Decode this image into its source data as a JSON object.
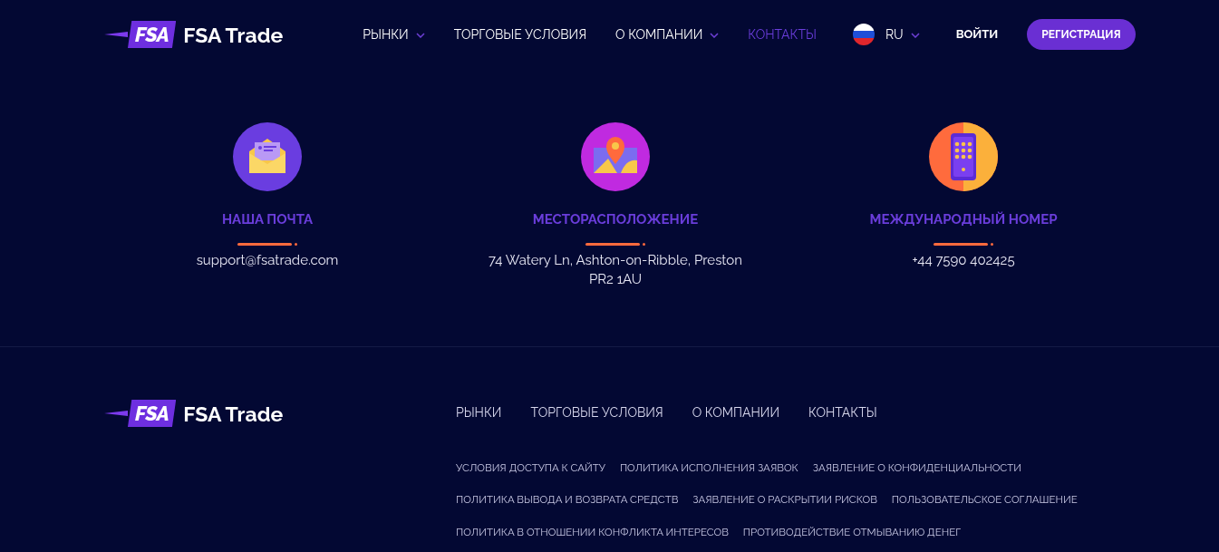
{
  "header": {
    "logo": {
      "mark": "FSA",
      "name": "FSA Trade"
    },
    "nav": [
      {
        "label": "РЫНКИ",
        "dropdown": true,
        "selected": false
      },
      {
        "label": "ТОРГОВЫЕ УСЛОВИЯ",
        "dropdown": false,
        "selected": false
      },
      {
        "label": "О КОМПАНИИ",
        "dropdown": true,
        "selected": false
      },
      {
        "label": "КОНТАКТЫ",
        "dropdown": false,
        "selected": true
      }
    ],
    "language": {
      "code": "RU"
    },
    "login": "ВОЙТИ",
    "register": "РЕГИСТРАЦИЯ"
  },
  "contacts": [
    {
      "kind": "mail",
      "title": "НАША ПОЧТА",
      "lines": [
        "support@fsatrade.com"
      ]
    },
    {
      "kind": "location",
      "title": "МЕСТОРАСПОЛОЖЕНИЕ",
      "lines": [
        "74 Watery Ln, Ashton-on-Ribble, Preston",
        "PR2 1AU"
      ]
    },
    {
      "kind": "phone",
      "title": "МЕЖДУНАРОДНЫЙ НОМЕР",
      "lines": [
        "+44 7590 402425"
      ]
    }
  ],
  "footer": {
    "logo": {
      "mark": "FSA",
      "name": "FSA Trade"
    },
    "nav": [
      "РЫНКИ",
      "ТОРГОВЫЕ УСЛОВИЯ",
      "О КОМПАНИИ",
      "КОНТАКТЫ"
    ],
    "legal_rows": [
      [
        "УСЛОВИЯ ДОСТУПА К САЙТУ",
        "ПОЛИТИКА ИСПОЛНЕНИЯ ЗАЯВОК",
        "ЗАЯВЛЕНИЕ О КОНФИДЕНЦИАЛЬНОСТИ"
      ],
      [
        "ПОЛИТИКА ВЫВОДА И ВОЗВРАТА СРЕДСТВ",
        "ЗАЯВЛЕНИЕ О РАСКРЫТИИ РИСКОВ",
        "ПОЛЬЗОВАТЕЛЬСКОЕ СОГЛАШЕНИЕ"
      ],
      [
        "ПОЛИТИКА В ОТНОШЕНИИ КОНФЛИКТА ИНТЕРЕСОВ",
        "ПРОТИВОДЕЙСТВИЕ ОТМЫВАНИЮ ДЕНЕГ"
      ]
    ]
  }
}
